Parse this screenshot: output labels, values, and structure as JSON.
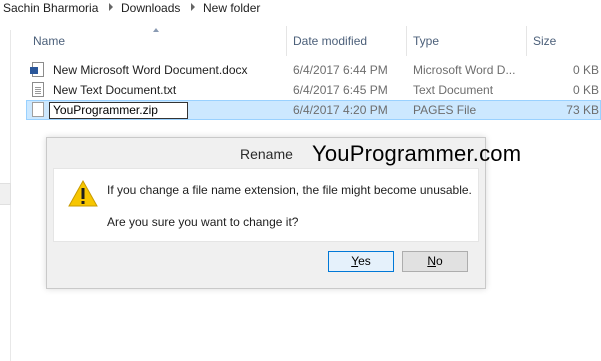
{
  "breadcrumb": {
    "items": [
      "Sachin Bharmoria",
      "Downloads",
      "New folder"
    ]
  },
  "columns": {
    "name": "Name",
    "date_modified": "Date modified",
    "type": "Type",
    "size": "Size"
  },
  "files": [
    {
      "name": "New Microsoft Word Document.docx",
      "date": "6/4/2017 6:44 PM",
      "type": "Microsoft Word D...",
      "size": "0 KB",
      "icon": "word-doc-icon"
    },
    {
      "name": "New Text Document.txt",
      "date": "6/4/2017 6:45 PM",
      "type": "Text Document",
      "size": "0 KB",
      "icon": "text-file-icon"
    },
    {
      "name": "YouProgrammer.zip",
      "date": "6/4/2017 4:20 PM",
      "type": "PAGES File",
      "size": "73 KB",
      "icon": "file-icon"
    }
  ],
  "dialog": {
    "title": "Rename",
    "message": "If you change a file name extension, the file might become unusable.",
    "question": "Are you sure you want to change it?",
    "yes_label": "Yes",
    "yes_first": "Y",
    "yes_rest": "es",
    "no_label": "No",
    "no_first": "N",
    "no_rest": "o",
    "icon": "warning-icon"
  },
  "watermark": "YouProgrammer.com",
  "colors": {
    "selection": "#cce8ff",
    "header_text": "#4c607a",
    "default_button_border": "#0078d7"
  }
}
